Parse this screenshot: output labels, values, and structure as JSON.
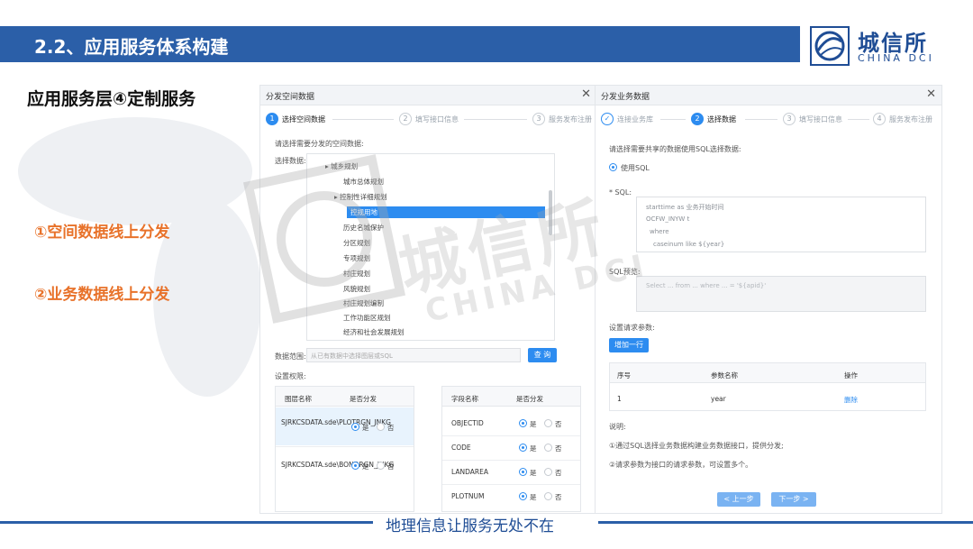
{
  "header": {
    "title": "2.2、应用服务体系构建",
    "bar_color": "#2b5fa8"
  },
  "logo": {
    "name_cn": "城信所",
    "name_en": "CHINA DCI",
    "icon": "globe-logo-icon"
  },
  "section_title": "应用服务层④定制服务",
  "bullets": [
    "①空间数据线上分发",
    "②业务数据线上分发"
  ],
  "accent_color": "#e8722a",
  "panel_spatial": {
    "title": "分发空间数据",
    "close_icon": "close-icon",
    "steps": [
      {
        "num": "1",
        "label": "选择空间数据",
        "state": "active"
      },
      {
        "num": "2",
        "label": "填写接口信息",
        "state": "todo"
      },
      {
        "num": "3",
        "label": "服务发布注册",
        "state": "todo"
      }
    ],
    "hint": "请选择需要分发的空间数据:",
    "select_label": "选择数据:",
    "tree": [
      "城乡规划",
      "城市总体规划",
      "控制性详细规划",
      "控规用地",
      "历史名城保护",
      "分区规划",
      "专项规划",
      "村庄规划",
      "风貌规划",
      "村庄规划编制",
      "工作功能区规划",
      "经济和社会发展规划"
    ],
    "tree_selected": "控规用地",
    "range_label": "数据范围:",
    "range_placeholder": "从已有数据中选择图层或SQL",
    "query_button": "查 询",
    "settings_label": "设置权限:",
    "layer_table": {
      "headers": [
        "图层名称",
        "是否分发"
      ],
      "rows": [
        {
          "name": "SJRKCSDATA.sde\\PLOTRGN_JNKG",
          "choice": "是"
        },
        {
          "name": "SJRKCSDATA.sde\\BONDRGN_JNKG",
          "choice": "是"
        }
      ]
    },
    "field_table": {
      "headers": [
        "字段名称",
        "是否分发"
      ],
      "rows": [
        {
          "name": "OBJECTID",
          "choice": "是"
        },
        {
          "name": "CODE",
          "choice": "是"
        },
        {
          "name": "LANDAREA",
          "choice": "是"
        },
        {
          "name": "PLOTNUM",
          "choice": "是"
        }
      ]
    },
    "yes": "是",
    "no": "否"
  },
  "panel_business": {
    "title": "分发业务数据",
    "close_icon": "close-icon",
    "steps": [
      {
        "num": "✓",
        "label": "连接业务库",
        "state": "done"
      },
      {
        "num": "2",
        "label": "选择数据",
        "state": "active"
      },
      {
        "num": "3",
        "label": "填写接口信息",
        "state": "todo"
      },
      {
        "num": "4",
        "label": "服务发布注册",
        "state": "todo"
      }
    ],
    "hint": "请选择需要共享的数据使用SQL选择数据:",
    "use_sql": "使用SQL",
    "sql_label": "* SQL:",
    "sql_lines": [
      "starttime as 业务开始时间",
      "OCFW_INYW t",
      "where",
      "caseinum like ${year}"
    ],
    "sql_preview_label": "SQL预览:",
    "sql_preview": "Select ... from ... where ... = '${apid}'",
    "params_label": "设置请求参数:",
    "add_row_button": "增加一行",
    "param_table": {
      "headers": [
        "序号",
        "参数名称",
        "操作"
      ],
      "rows": [
        {
          "index": "1",
          "name": "year",
          "action": "删除"
        }
      ]
    },
    "notes_label": "说明:",
    "notes": [
      "①通过SQL选择业务数据构建业务数据接口，提供分发;",
      "②请求参数为接口的请求参数，可设置多个。"
    ],
    "prev_button": "< 上一步",
    "next_button": "下一步 >"
  },
  "watermark": {
    "cn": "城信所",
    "en": "CHINA DCI"
  },
  "footer": "地理信息让服务无处不在"
}
